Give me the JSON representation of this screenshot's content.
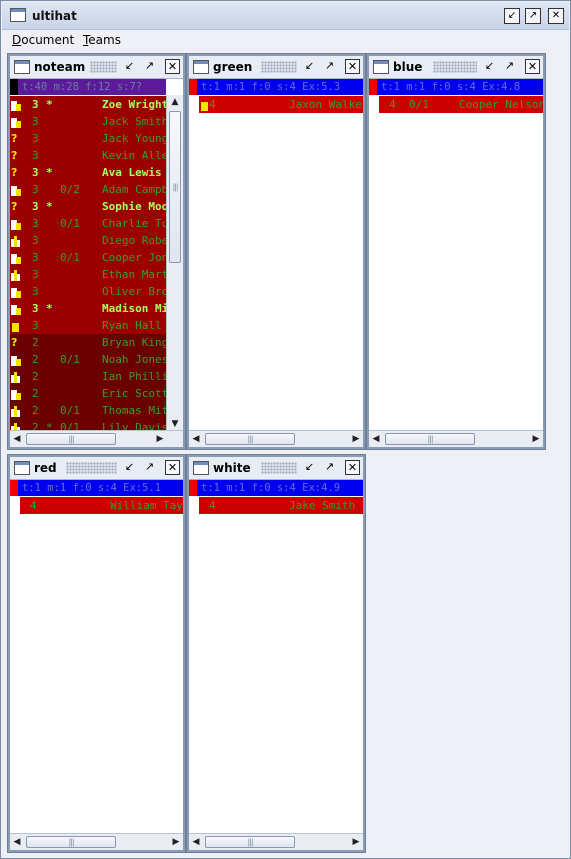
{
  "app": {
    "title": "ultihat"
  },
  "menu": [
    {
      "label": "Document",
      "accel": "D"
    },
    {
      "label": "Teams",
      "accel": "T"
    }
  ],
  "colors": {
    "desktop_frame": "#8a9cb3",
    "noteam_status_bg": "#5a1a9a",
    "team_status_bg": "#0000ee",
    "team_status_fg": "#6a6ad8",
    "row_red": "#cc0000",
    "row_darkred": "#9a0000",
    "row_maroon": "#6a0000",
    "text_green": "#3e9a2e",
    "text_green_bright": "#a8ff60"
  },
  "panels": [
    {
      "name": "noteam",
      "status": "t:40  m:28  f:12  s:7?",
      "status_bg": "#5a1a9a",
      "status_fg": "#6e7c9e",
      "players": [
        {
          "skill": "3",
          "star": "*",
          "ratio": "",
          "name": "Zoe Wright",
          "bg": "#9a0000",
          "fg": "#a8ff60",
          "bold": true,
          "marker": "white-yellow"
        },
        {
          "skill": "3",
          "star": "",
          "ratio": "",
          "name": "Jack Smith",
          "bg": "#9a0000",
          "fg": "#3e9a2e",
          "bold": false,
          "marker": "white-yellow"
        },
        {
          "skill": "3",
          "star": "",
          "ratio": "",
          "name": "Jack Young",
          "bg": "#9a0000",
          "fg": "#3e9a2e",
          "bold": false,
          "marker": "question"
        },
        {
          "skill": "3",
          "star": "",
          "ratio": "",
          "name": "Kevin Allen",
          "bg": "#9a0000",
          "fg": "#3e9a2e",
          "bold": false,
          "marker": "question"
        },
        {
          "skill": "3",
          "star": "*",
          "ratio": "",
          "name": "Ava Lewis",
          "bg": "#9a0000",
          "fg": "#a8ff60",
          "bold": true,
          "marker": "question"
        },
        {
          "skill": "3",
          "star": "",
          "ratio": "0/2",
          "name": "Adam Campbell",
          "bg": "#9a0000",
          "fg": "#3e9a2e",
          "bold": false,
          "marker": "white-yellow"
        },
        {
          "skill": "3",
          "star": "*",
          "ratio": "",
          "name": "Sophie Moore",
          "bg": "#9a0000",
          "fg": "#a8ff60",
          "bold": true,
          "marker": "question"
        },
        {
          "skill": "3",
          "star": "",
          "ratio": "0/1",
          "name": "Charlie Turner",
          "bg": "#9a0000",
          "fg": "#3e9a2e",
          "bold": false,
          "marker": "white-yellow"
        },
        {
          "skill": "3",
          "star": "",
          "ratio": "",
          "name": "Diego Roberts",
          "bg": "#9a0000",
          "fg": "#3e9a2e",
          "bold": false,
          "marker": "bars"
        },
        {
          "skill": "3",
          "star": "",
          "ratio": "0/1",
          "name": "Cooper Jones",
          "bg": "#9a0000",
          "fg": "#3e9a2e",
          "bold": false,
          "marker": "white-yellow"
        },
        {
          "skill": "3",
          "star": "",
          "ratio": "",
          "name": "Ethan Martin",
          "bg": "#9a0000",
          "fg": "#3e9a2e",
          "bold": false,
          "marker": "bars"
        },
        {
          "skill": "3",
          "star": "",
          "ratio": "",
          "name": "Oliver Brown",
          "bg": "#9a0000",
          "fg": "#3e9a2e",
          "bold": false,
          "marker": "white-yellow"
        },
        {
          "skill": "3",
          "star": "*",
          "ratio": "",
          "name": "Madison Miller",
          "bg": "#9a0000",
          "fg": "#a8ff60",
          "bold": true,
          "marker": "white-yellow"
        },
        {
          "skill": "3",
          "star": "",
          "ratio": "",
          "name": "Ryan Hall",
          "bg": "#9a0000",
          "fg": "#3e9a2e",
          "bold": false,
          "marker": "yellow"
        },
        {
          "skill": "2",
          "star": "",
          "ratio": "",
          "name": "Bryan King",
          "bg": "#6a0000",
          "fg": "#3e9a2e",
          "bold": false,
          "marker": "question"
        },
        {
          "skill": "2",
          "star": "",
          "ratio": "0/1",
          "name": "Noah Jones",
          "bg": "#6a0000",
          "fg": "#3e9a2e",
          "bold": false,
          "marker": "white-yellow"
        },
        {
          "skill": "2",
          "star": "",
          "ratio": "",
          "name": "Ian Phillips",
          "bg": "#6a0000",
          "fg": "#3e9a2e",
          "bold": false,
          "marker": "bars"
        },
        {
          "skill": "2",
          "star": "",
          "ratio": "",
          "name": "Eric Scott",
          "bg": "#6a0000",
          "fg": "#3e9a2e",
          "bold": false,
          "marker": "white-yellow"
        },
        {
          "skill": "2",
          "star": "",
          "ratio": "0/1",
          "name": "Thomas Mitchell",
          "bg": "#6a0000",
          "fg": "#3e9a2e",
          "bold": false,
          "marker": "bars"
        },
        {
          "skill": "2",
          "star": "*",
          "ratio": "0/1",
          "name": "Lily Davis",
          "bg": "#6a0000",
          "fg": "#3e9a2e",
          "bold": false,
          "marker": "bars"
        }
      ]
    },
    {
      "name": "green",
      "status": "t:1  m:1  f:0  s:4  Ex:5.3",
      "status_bg": "#0000ee",
      "status_fg": "#6a6ad8",
      "players": [
        {
          "skill": "4",
          "star": "",
          "ratio": "",
          "name": "Jaxon Walker",
          "bg": "#cc0000",
          "fg": "#3e9a2e",
          "bold": false,
          "marker": "yellow"
        }
      ]
    },
    {
      "name": "blue",
      "status": "t:1  m:1  f:0  s:4  Ex:4.8",
      "status_bg": "#0000ee",
      "status_fg": "#6a6ad8",
      "players": [
        {
          "skill": "4",
          "star": "",
          "ratio": "0/1",
          "name": "Cooper Nelson",
          "bg": "#cc0000",
          "fg": "#3e9a2e",
          "bold": false,
          "marker": "none"
        }
      ]
    },
    {
      "name": "red",
      "status": "t:1  m:1  f:0  s:4  Ex:5.1",
      "status_bg": "#0000ee",
      "status_fg": "#6a6ad8",
      "players": [
        {
          "skill": "4",
          "star": "",
          "ratio": "",
          "name": "William Taylor",
          "bg": "#cc0000",
          "fg": "#3e9a2e",
          "bold": false,
          "marker": "none"
        }
      ]
    },
    {
      "name": "white",
      "status": "t:1  m:1  f:0  s:4  Ex:4.9",
      "status_bg": "#0000ee",
      "status_fg": "#6a6ad8",
      "players": [
        {
          "skill": "4",
          "star": "",
          "ratio": "",
          "name": "Jake Smith",
          "bg": "#cc0000",
          "fg": "#3e9a2e",
          "bold": false,
          "marker": "none"
        }
      ]
    }
  ]
}
